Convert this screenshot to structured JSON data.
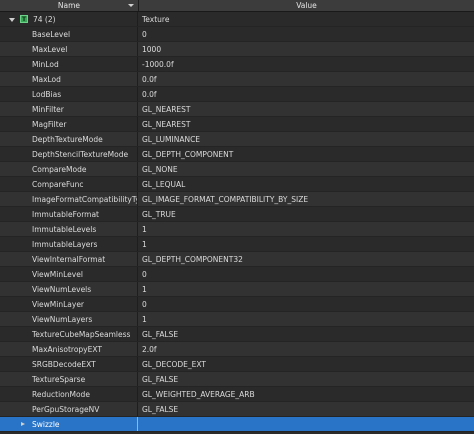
{
  "header": {
    "name": "Name",
    "value": "Value"
  },
  "root": {
    "name": "74 (2)",
    "value": "Texture",
    "icon": "texture-icon"
  },
  "rows": [
    {
      "name": "BaseLevel",
      "value": "0"
    },
    {
      "name": "MaxLevel",
      "value": "1000"
    },
    {
      "name": "MinLod",
      "value": "-1000.0f"
    },
    {
      "name": "MaxLod",
      "value": "0.0f"
    },
    {
      "name": "LodBias",
      "value": "0.0f"
    },
    {
      "name": "MinFilter",
      "value": "GL_NEAREST"
    },
    {
      "name": "MagFilter",
      "value": "GL_NEAREST"
    },
    {
      "name": "DepthTextureMode",
      "value": "GL_LUMINANCE"
    },
    {
      "name": "DepthStencilTextureMode",
      "value": "GL_DEPTH_COMPONENT"
    },
    {
      "name": "CompareMode",
      "value": "GL_NONE"
    },
    {
      "name": "CompareFunc",
      "value": "GL_LEQUAL"
    },
    {
      "name": "ImageFormatCompatibilityType",
      "value": "GL_IMAGE_FORMAT_COMPATIBILITY_BY_SIZE"
    },
    {
      "name": "ImmutableFormat",
      "value": "GL_TRUE"
    },
    {
      "name": "ImmutableLevels",
      "value": "1"
    },
    {
      "name": "ImmutableLayers",
      "value": "1"
    },
    {
      "name": "ViewInternalFormat",
      "value": "GL_DEPTH_COMPONENT32"
    },
    {
      "name": "ViewMinLevel",
      "value": "0"
    },
    {
      "name": "ViewNumLevels",
      "value": "1"
    },
    {
      "name": "ViewMinLayer",
      "value": "0"
    },
    {
      "name": "ViewNumLayers",
      "value": "1"
    },
    {
      "name": "TextureCubeMapSeamless",
      "value": "GL_FALSE"
    },
    {
      "name": "MaxAnisotropyEXT",
      "value": "2.0f"
    },
    {
      "name": "SRGBDecodeEXT",
      "value": "GL_DECODE_EXT"
    },
    {
      "name": "TextureSparse",
      "value": "GL_FALSE"
    },
    {
      "name": "ReductionMode",
      "value": "GL_WEIGHTED_AVERAGE_ARB"
    },
    {
      "name": "PerGpuStorageNV",
      "value": "GL_FALSE"
    }
  ],
  "selected": {
    "name": "Swizzle",
    "value": ""
  },
  "colors": {
    "selection": "#2a74c7",
    "icon": "#3aa856"
  }
}
